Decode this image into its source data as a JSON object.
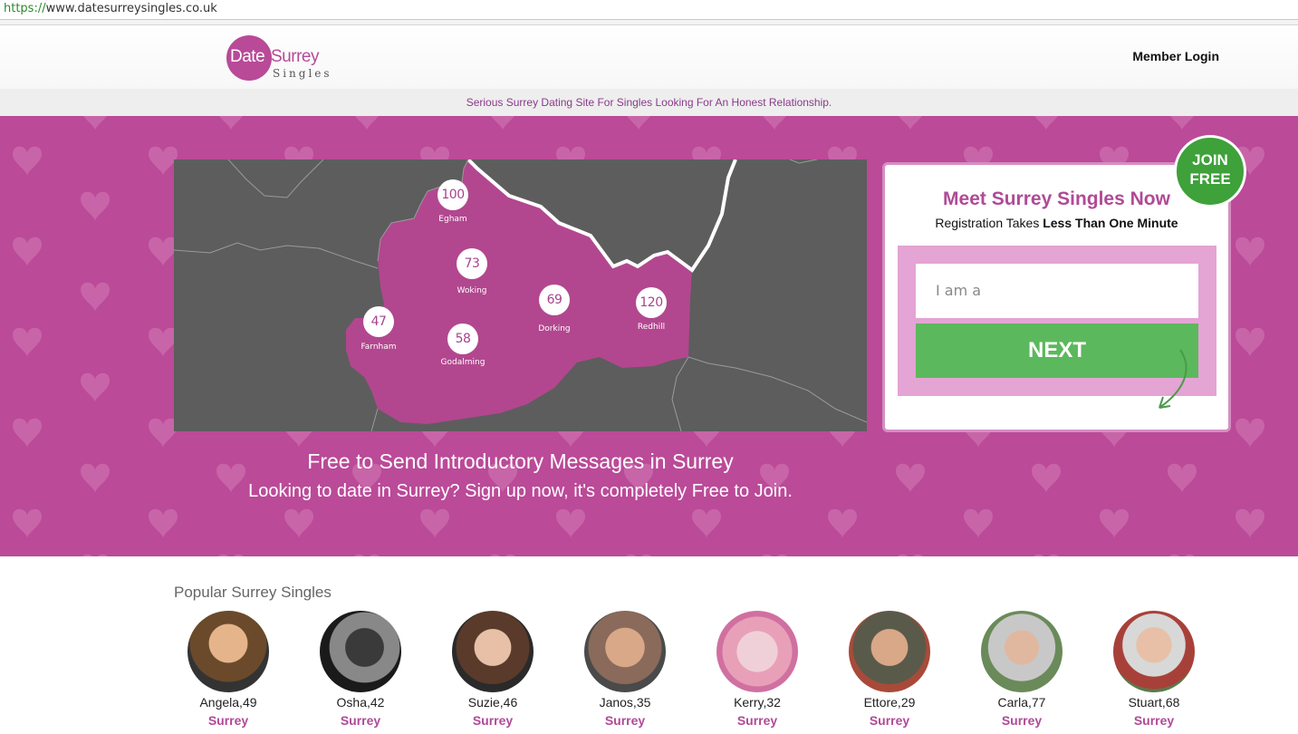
{
  "browser": {
    "url_protocol": "https://",
    "url_rest": "www.datesurreysingles.co.uk"
  },
  "header": {
    "logo": {
      "date": "Date",
      "surrey": "Surrey",
      "singles": "Singles"
    },
    "member_login": "Member Login",
    "tagline": "Serious Surrey Dating Site For Singles Looking For An Honest Relationship."
  },
  "map": {
    "pins": [
      {
        "count": "100",
        "town": "Egham"
      },
      {
        "count": "73",
        "town": "Woking"
      },
      {
        "count": "69",
        "town": "Dorking"
      },
      {
        "count": "120",
        "town": "Redhill"
      },
      {
        "count": "47",
        "town": "Farnham"
      },
      {
        "count": "58",
        "town": "Godalming"
      }
    ]
  },
  "hero": {
    "heading": "Free to Send Introductory Messages in Surrey",
    "subheading": "Looking to date in Surrey? Sign up now, it's completely Free to Join."
  },
  "signup": {
    "badge_line1": "JOIN",
    "badge_line2": "FREE",
    "title": "Meet Surrey Singles Now",
    "sub_prefix": "Registration Takes",
    "sub_bold": "Less Than One Minute",
    "select_placeholder": "I am a",
    "next_label": "NEXT"
  },
  "popular": {
    "heading": "Popular Surrey Singles",
    "profiles": [
      {
        "name": "Angela,49",
        "location": "Surrey"
      },
      {
        "name": "Osha,42",
        "location": "Surrey"
      },
      {
        "name": "Suzie,46",
        "location": "Surrey"
      },
      {
        "name": "Janos,35",
        "location": "Surrey"
      },
      {
        "name": "Kerry,32",
        "location": "Surrey"
      },
      {
        "name": "Ettore,29",
        "location": "Surrey"
      },
      {
        "name": "Carla,77",
        "location": "Surrey"
      },
      {
        "name": "Stuart,68",
        "location": "Surrey"
      }
    ]
  },
  "colors": {
    "brand_pink": "#bb4a98",
    "accent_green": "#5cb85c",
    "badge_green": "#3ea13a"
  }
}
